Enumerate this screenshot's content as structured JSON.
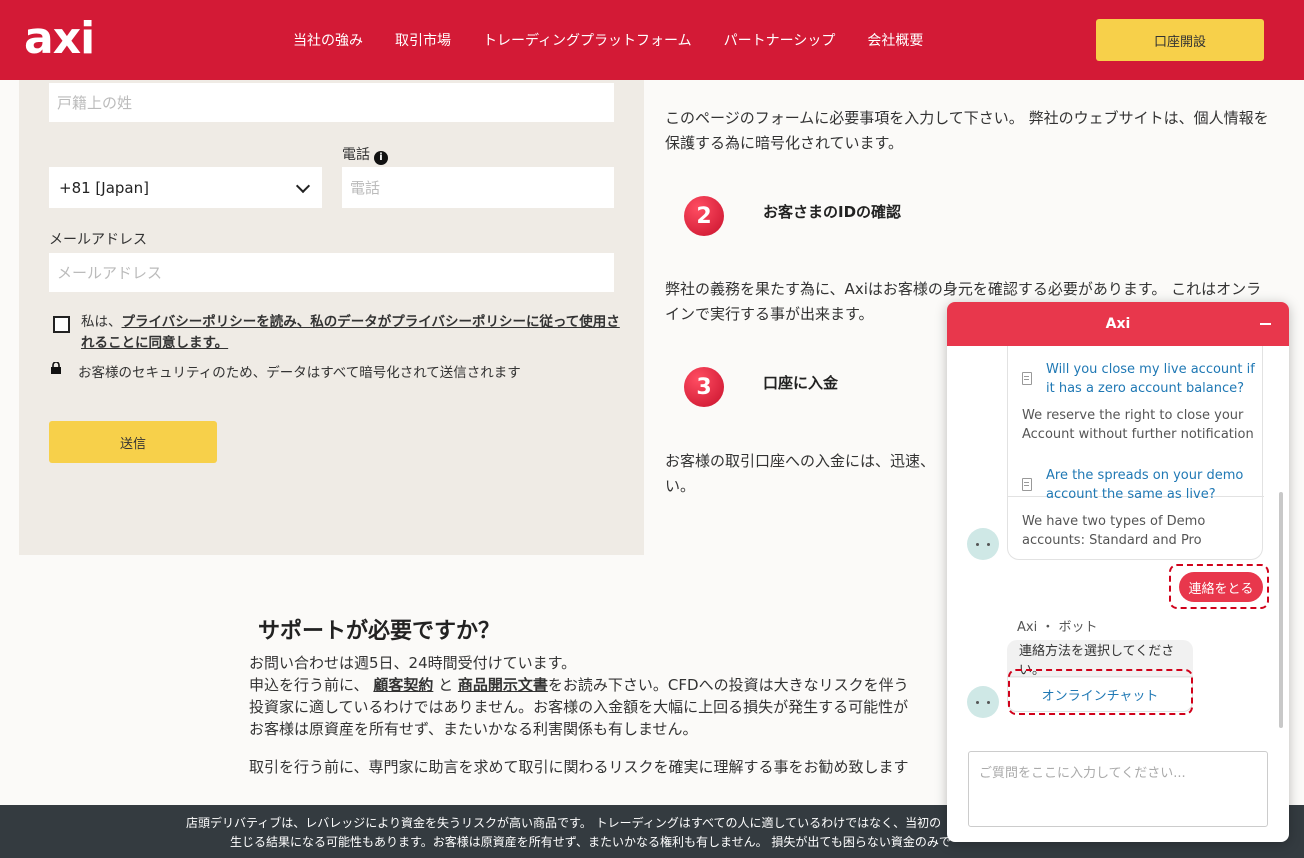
{
  "header": {
    "logo": "axi",
    "nav": [
      "当社の強み",
      "取引市場",
      "トレーディングプラットフォーム",
      "パートナーシップ",
      "会社概要"
    ],
    "open_account": "口座開設"
  },
  "form": {
    "surname_placeholder": "戸籍上の姓",
    "phone_label": "電話",
    "country_code": "+81 [Japan]",
    "phone_placeholder": "電話",
    "email_label": "メールアドレス",
    "email_placeholder": "メールアドレス",
    "consent_prefix": "私は、",
    "consent_link": "プライバシーポリシーを読み、私のデータがプライバシーポリシーに従って使用されることに同意します。",
    "security_note": "お客様のセキュリティのため、データはすべて暗号化されて送信されます",
    "submit": "送信"
  },
  "steps": {
    "intro": "このページのフォームに必要事項を入力して下さい。 弊社のウェブサイトは、個人情報を保護する為に暗号化されています。",
    "step2_num": "2",
    "step2_title": "お客さまのIDの確認",
    "step2_text": "弊社の義務を果たす為に、Axiはお客様の身元を確認する必要があります。 これはオンラインで実行する事が出来ます。",
    "step3_num": "3",
    "step3_title": "口座に入金",
    "step3_text": "お客様の取引口座への入金には、迅速、",
    "step3_text2": "い。"
  },
  "support": {
    "title": "サポートが必要ですか？",
    "line1": "お問い合わせは週5日、24時間受付けています。",
    "line2_a": "申込を行う前に、",
    "line2_link1": "顧客契約",
    "line2_b": " と ",
    "line2_link2": "商品開示文書",
    "line2_c": "をお読み下さい。CFDへの投資は大きなリスクを伴う",
    "line3": "投資家に適しているわけではありません。お客様の入金額を大幅に上回る損失が発生する可能性が",
    "line4": "お客様は原資産を所有せず、またいかなる利害関係も有しません。",
    "line5": "取引を行う前に、専門家に助言を求めて取引に関わるリスクを確実に理解する事をお勧め致します"
  },
  "footer": {
    "line1": "店頭デリバティブは、レバレッジにより資金を失うリスクが高い商品です。 トレーディングはすべての人に適しているわけではなく、当初の",
    "line2": "生じる結果になる可能性もあります。お客様は原資産を所有せず、またいかなる権利も有しません。 損失が出ても困らない資金のみで"
  },
  "chat": {
    "title": "Axi",
    "cards": [
      {
        "question": "Will you close my live account if it has a zero account balance?",
        "answer": "We reserve the right to close your Account without further notification"
      },
      {
        "question": "Are the spreads on your demo account the same as live?",
        "answer": "We have two types of Demo accounts: Standard and Pro"
      }
    ],
    "contact_button": "連絡をとる",
    "bot_name": "Axi ・ ボット",
    "bot_message": "連絡方法を選択してください。",
    "option": "オンラインチャット",
    "input_placeholder": "ご質問をここに入力してください..."
  },
  "colors": {
    "brand_red": "#d31a36",
    "cta_yellow": "#f7d04a",
    "chat_red": "#e8374c",
    "link_blue": "#1f78b4"
  }
}
